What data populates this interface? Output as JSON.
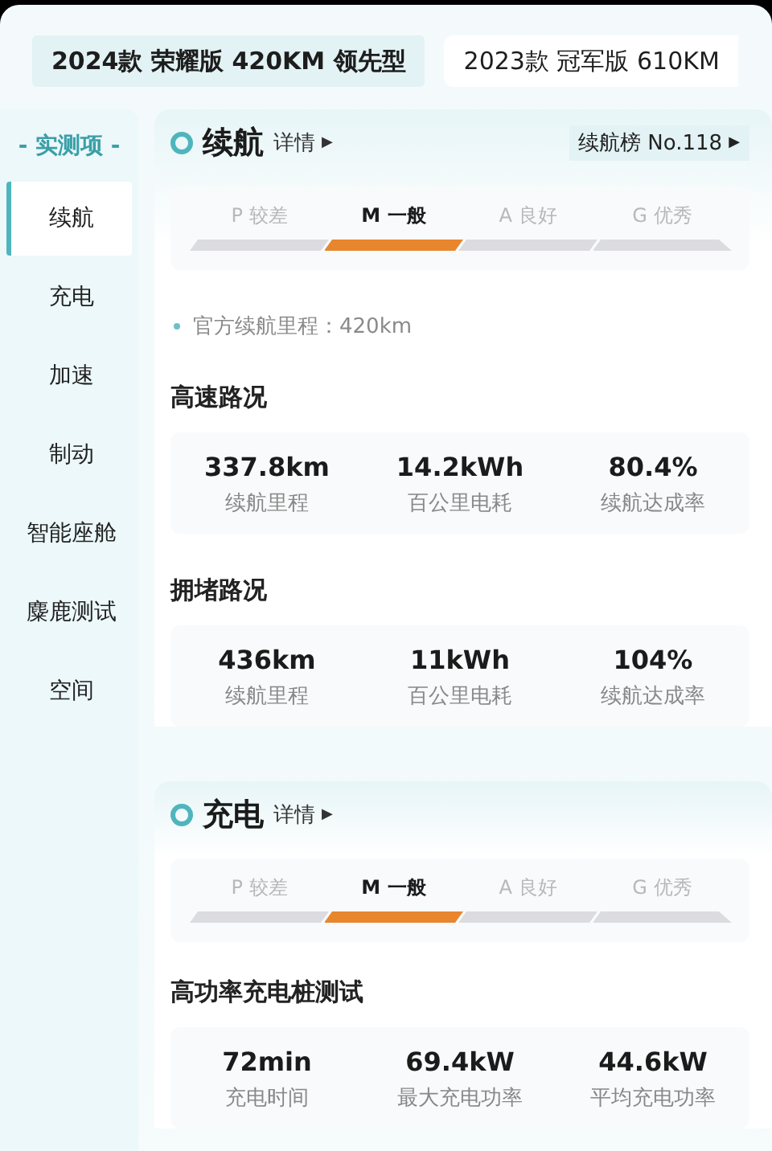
{
  "car_tabs": [
    {
      "label": "2024款 荣耀版 420KM 领先型",
      "selected": true
    },
    {
      "label": "2023款 冠军版 610KM",
      "selected": false
    }
  ],
  "sidebar": {
    "header": "- 实测项 -",
    "items": [
      {
        "label": "续航",
        "selected": true
      },
      {
        "label": "充电",
        "selected": false
      },
      {
        "label": "加速",
        "selected": false
      },
      {
        "label": "制动",
        "selected": false
      },
      {
        "label": "智能座舱",
        "selected": false
      },
      {
        "label": "麋鹿测试",
        "selected": false
      },
      {
        "label": "空间",
        "selected": false
      }
    ]
  },
  "sections": [
    {
      "title": "续航",
      "detail": "详情",
      "detail_arrow": "▶",
      "rank": {
        "label": "续航榜 No.118",
        "arrow": "▶"
      },
      "ratings": [
        {
          "grade": "P",
          "label": "较差",
          "selected": false
        },
        {
          "grade": "M",
          "label": "一般",
          "selected": true
        },
        {
          "grade": "A",
          "label": "良好",
          "selected": false
        },
        {
          "grade": "G",
          "label": "优秀",
          "selected": false
        }
      ],
      "note": "官方续航里程：420km",
      "groups": [
        {
          "title": "高速路况",
          "stats": [
            {
              "value": "337.8km",
              "label": "续航里程"
            },
            {
              "value": "14.2kWh",
              "label": "百公里电耗"
            },
            {
              "value": "80.4%",
              "label": "续航达成率"
            }
          ]
        },
        {
          "title": "拥堵路况",
          "stats": [
            {
              "value": "436km",
              "label": "续航里程"
            },
            {
              "value": "11kWh",
              "label": "百公里电耗"
            },
            {
              "value": "104%",
              "label": "续航达成率"
            }
          ]
        }
      ]
    },
    {
      "title": "充电",
      "detail": "详情",
      "detail_arrow": "▶",
      "ratings": [
        {
          "grade": "P",
          "label": "较差",
          "selected": false
        },
        {
          "grade": "M",
          "label": "一般",
          "selected": true
        },
        {
          "grade": "A",
          "label": "良好",
          "selected": false
        },
        {
          "grade": "G",
          "label": "优秀",
          "selected": false
        }
      ],
      "groups": [
        {
          "title": "高功率充电桩测试",
          "stats": [
            {
              "value": "72min",
              "label": "充电时间"
            },
            {
              "value": "69.4kW",
              "label": "最大充电功率"
            },
            {
              "value": "44.6kW",
              "label": "平均充电功率"
            }
          ]
        }
      ]
    }
  ]
}
